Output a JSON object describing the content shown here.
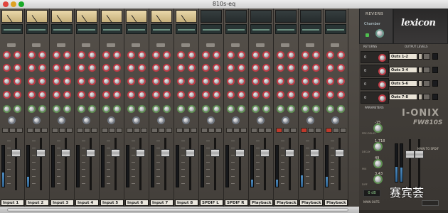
{
  "window": {
    "title": "810s-eq"
  },
  "channels": [
    {
      "label": "Input 1",
      "meter": "vu",
      "level": 0.34
    },
    {
      "label": "Input 2",
      "meter": "vu",
      "level": 0.25
    },
    {
      "label": "Input 3",
      "meter": "vu",
      "level": 0.0
    },
    {
      "label": "Input 4",
      "meter": "vu",
      "level": 0.0
    },
    {
      "label": "Input 5",
      "meter": "vu",
      "level": 0.0
    },
    {
      "label": "Input 6",
      "meter": "vu",
      "level": 0.0
    },
    {
      "label": "Input 7",
      "meter": "vu",
      "level": 0.0
    },
    {
      "label": "Input 8",
      "meter": "vu",
      "level": 0.0
    },
    {
      "label": "SPDIF L",
      "meter": "eq",
      "level": 0.0
    },
    {
      "label": "SPDIF R",
      "meter": "eq",
      "level": 0.0
    },
    {
      "label": "Playback 1",
      "meter": "eq",
      "level": 0.18
    },
    {
      "label": "Playback 2",
      "meter": "eq",
      "level": 0.18
    },
    {
      "label": "Playback 3",
      "meter": "eq",
      "level": 0.28
    },
    {
      "label": "Playback 4",
      "meter": "eq",
      "level": 0.24
    }
  ],
  "reverb": {
    "title": "REVERB",
    "preset": "Chamber"
  },
  "brand": {
    "name": "lexicon",
    "model": "I-ONIX",
    "model_sub": "FW810S"
  },
  "returns": {
    "title": "RETURNS",
    "values": [
      "0",
      "0",
      "0",
      "0"
    ]
  },
  "output_levels": {
    "title": "OUTPUT LEVELS",
    "outs": [
      "Outs 1-2",
      "Outs 3-4",
      "Outs 5-6",
      "Outs 7-8"
    ]
  },
  "parameters": {
    "title": "PARAMETERS",
    "items": [
      {
        "value": "-15",
        "label": "PRE-DELAY"
      },
      {
        "value": "1.718",
        "label": "DECAY"
      },
      {
        "value": "49",
        "label": "MIX"
      },
      {
        "value": "3.43",
        "label": "DIFF"
      }
    ]
  },
  "main": {
    "value": "0 dB",
    "label": "MAIN OUTS",
    "stereo": "MAIN TO SPDIF"
  },
  "watermark": "赛宾荟"
}
